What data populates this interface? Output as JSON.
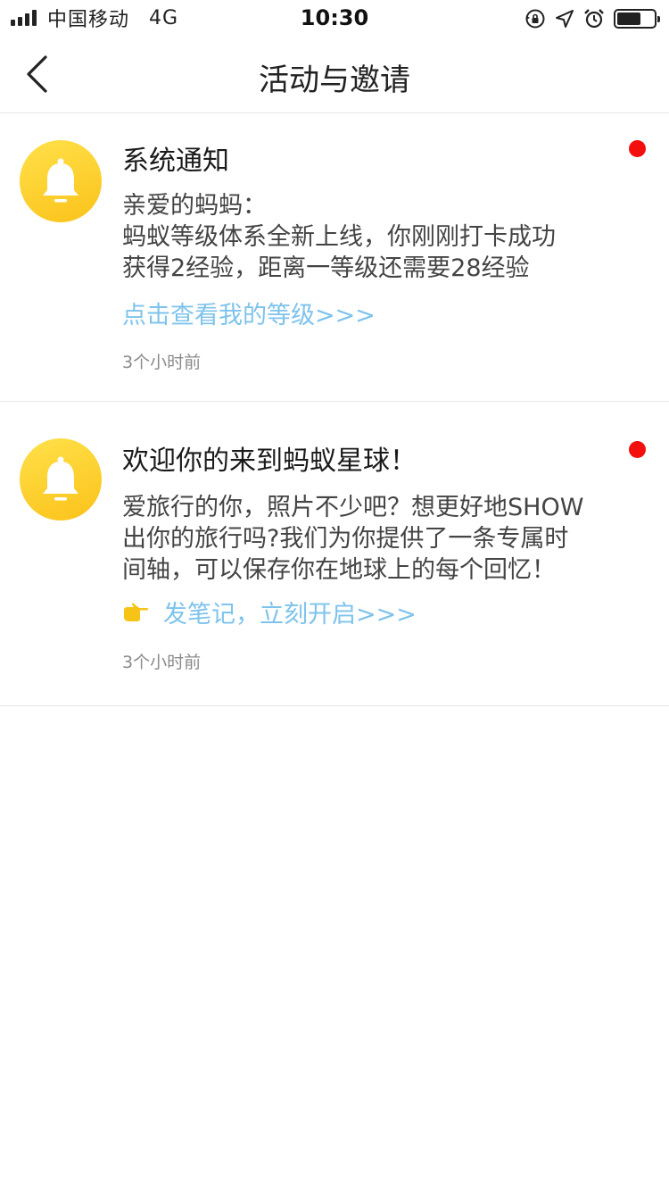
{
  "status_bar": {
    "carrier": "中国移动",
    "network": "4G",
    "time": "10:30",
    "battery_level": 0.65
  },
  "nav": {
    "title": "活动与邀请"
  },
  "notifications": [
    {
      "title": "系统通知",
      "unread": true,
      "body_lines": [
        "亲爱的蚂蚂：",
        "蚂蚁等级体系全新上线，你刚刚打卡成功",
        "获得2经验，距离一等级还需要28经验"
      ],
      "link_text": "点击查看我的等级>>>",
      "time": "3个小时前",
      "icon": "bell-icon"
    },
    {
      "title": "欢迎你的来到蚂蚁星球！",
      "unread": true,
      "body_lines": [
        "爱旅行的你，照片不少吧？想更好地SHOW",
        "出你的旅行吗?我们为你提供了一条专属时",
        "间轴，可以保存你在地球上的每个回忆！"
      ],
      "link_text": "发笔记，立刻开启>>>",
      "link_icon": "pointing-hand-icon",
      "time": "3个小时前",
      "icon": "bell-icon"
    }
  ],
  "colors": {
    "accent_link": "#7ec3ec",
    "unread_dot": "#f40f0f",
    "avatar_yellow": "#fbc21a"
  }
}
